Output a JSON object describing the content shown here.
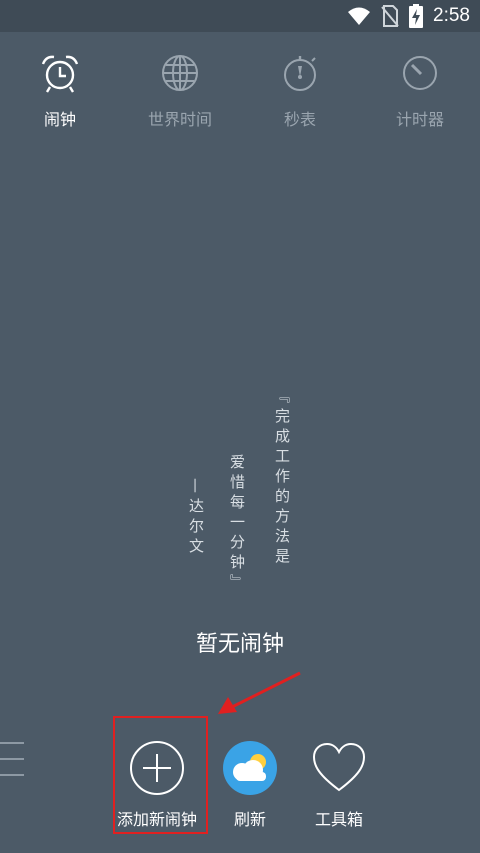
{
  "status_bar": {
    "time": "2:58",
    "icons": [
      "wifi-icon",
      "no-sim-icon",
      "battery-charging-icon"
    ]
  },
  "tabs": [
    {
      "label": "闹钟",
      "icon": "alarm-clock-icon",
      "active": true
    },
    {
      "label": "世界时间",
      "icon": "globe-icon",
      "active": false
    },
    {
      "label": "秒表",
      "icon": "stopwatch-icon",
      "active": false
    },
    {
      "label": "计时器",
      "icon": "timer-icon",
      "active": false
    }
  ],
  "quote": {
    "line1": "『完成工作的方法是",
    "line2": "爱惜每一分钟』",
    "author": "—达尔文"
  },
  "empty_state": "暂无闹钟",
  "actions": {
    "add_label": "添加新闹钟",
    "refresh_label": "刷新",
    "toolbox_label": "工具箱"
  },
  "colors": {
    "background": "#4c5a67",
    "highlight": "#e02020"
  }
}
